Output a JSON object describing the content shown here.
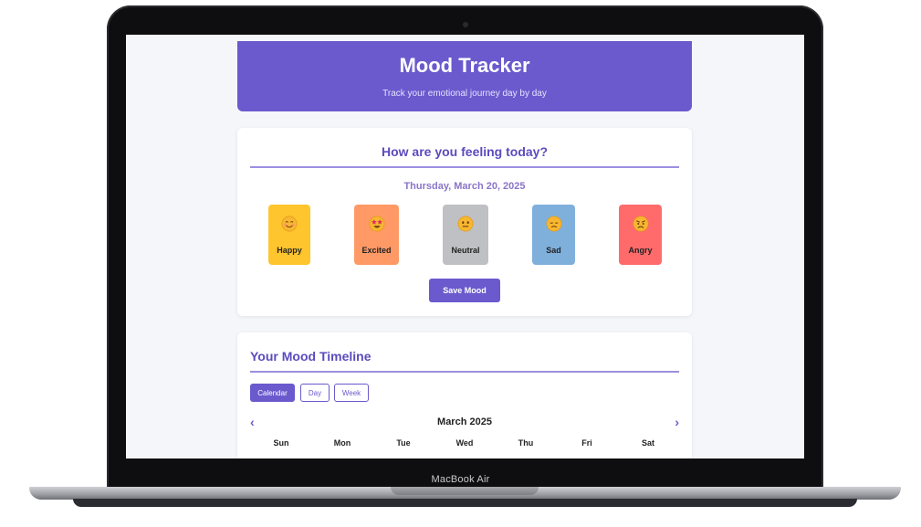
{
  "device": {
    "label": "MacBook Air"
  },
  "app": {
    "title": "Mood Tracker",
    "subtitle": "Track your emotional journey day by day"
  },
  "today": {
    "question": "How are you feeling today?",
    "date": "Thursday, March 20, 2025",
    "moods": [
      {
        "label": "Happy",
        "icon": "smiling-face-icon",
        "color": "#ffc52e"
      },
      {
        "label": "Excited",
        "icon": "star-struck-face-icon",
        "color": "#ff9966"
      },
      {
        "label": "Neutral",
        "icon": "neutral-face-icon",
        "color": "#bfc0c4"
      },
      {
        "label": "Sad",
        "icon": "sad-face-icon",
        "color": "#7fb0dc"
      },
      {
        "label": "Angry",
        "icon": "angry-face-icon",
        "color": "#ff6b6b"
      }
    ],
    "save_label": "Save Mood"
  },
  "timeline": {
    "title": "Your Mood Timeline",
    "tabs": [
      {
        "label": "Calendar",
        "active": true
      },
      {
        "label": "Day",
        "active": false
      },
      {
        "label": "Week",
        "active": false
      }
    ],
    "month": "March 2025",
    "weekdays": [
      "Sun",
      "Mon",
      "Tue",
      "Wed",
      "Thu",
      "Fri",
      "Sat"
    ]
  },
  "colors": {
    "accent": "#6a5acd"
  }
}
